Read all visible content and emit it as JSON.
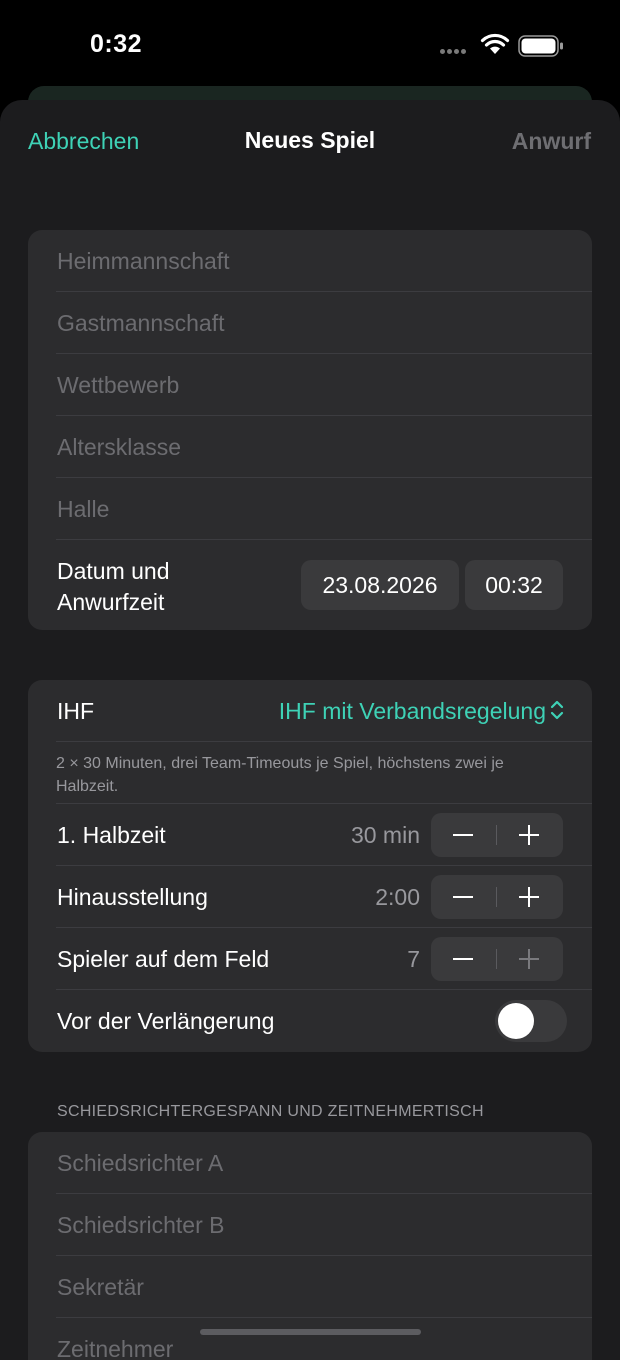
{
  "status_bar": {
    "time": "0:32"
  },
  "nav": {
    "cancel": "Abbrechen",
    "title": "Neues Spiel",
    "action": "Anwurf"
  },
  "teams": {
    "home_placeholder": "Heimmannschaft",
    "guest_placeholder": "Gastmannschaft",
    "competition_placeholder": "Wettbewerb",
    "age_placeholder": "Altersklasse",
    "hall_placeholder": "Halle",
    "datetime_label_1": "Datum und",
    "datetime_label_2": "Anwurfzeit",
    "date": "23.08.2026",
    "time": "00:32"
  },
  "rules": {
    "label": "IHF",
    "picker_value": "IHF mit Verbandsregelung",
    "description": "2 × 30 Minuten, drei Team-Timeouts je Spiel, höchstens zwei je Halbzeit.",
    "half_label": "1. Halbzeit",
    "half_value": "30 min",
    "suspension_label": "Hinausstellung",
    "suspension_value": "2:00",
    "players_label": "Spieler auf dem Feld",
    "players_value": "7",
    "overtime_label": "Vor der Verlängerung",
    "overtime_on": false
  },
  "officials": {
    "header": "SCHIEDSRICHTERGESPANN UND ZEITNEHMERTISCH",
    "referee_a_placeholder": "Schiedsrichter A",
    "referee_b_placeholder": "Schiedsrichter B",
    "secretary_placeholder": "Sekretär",
    "timekeeper_placeholder": "Zeitnehmer"
  },
  "colors": {
    "accent": "#3ed2b6",
    "background": "#1c1c1e",
    "card": "#2c2c2e"
  }
}
